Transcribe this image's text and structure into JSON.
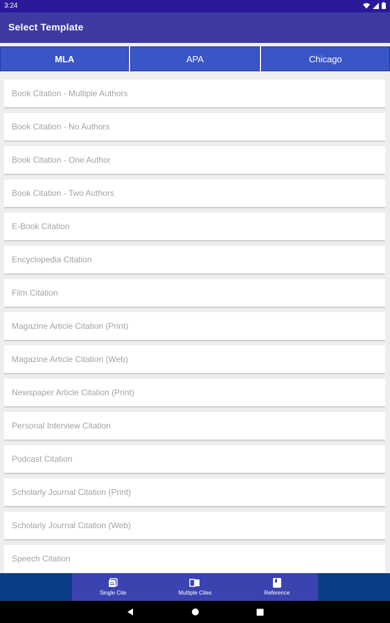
{
  "status_bar": {
    "time": "3:24"
  },
  "app_bar": {
    "title": "Select Template"
  },
  "tabs": [
    {
      "label": "MLA",
      "active": true
    },
    {
      "label": "APA",
      "active": false
    },
    {
      "label": "Chicago",
      "active": false
    }
  ],
  "templates": [
    "Book Citation - Multiple Authors",
    "Book Citation - No Authors",
    "Book Citation - One Author",
    "Book Citation - Two Authors",
    "E-Book Citation",
    "Encyclopedia Citation",
    "Film Citation",
    "Magazine Article Citation (Print)",
    "Magazine Article Citation (Web)",
    "Newspaper Article Citation (Print)",
    "Personal Interview Citation",
    "Podcast Citation",
    "Scholarly Journal Citation (Print)",
    "Scholarly Journal Citation (Web)",
    "Speech Citation"
  ],
  "bottom_nav": [
    {
      "label": "Single Cite",
      "icon": "single-cite-icon"
    },
    {
      "label": "Multiple Cites",
      "icon": "multiple-cites-icon"
    },
    {
      "label": "Reference",
      "icon": "reference-icon"
    }
  ],
  "colors": {
    "status_bar": "#2a1a9a",
    "app_bar": "#3d3aa1",
    "tab": "#3a55c6",
    "bottom_nav": "#0b3d86",
    "nav_inner": "#3b43b0",
    "item_text": "#a3a3a3"
  }
}
